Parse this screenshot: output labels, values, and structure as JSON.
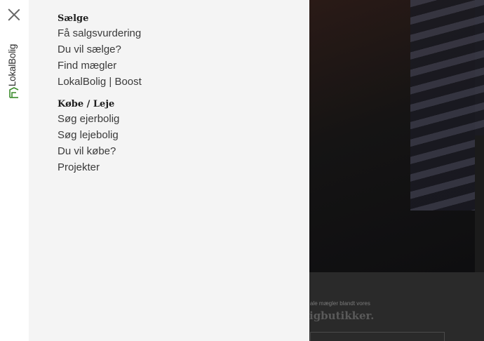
{
  "close": {
    "icon": "close-icon"
  },
  "brand": {
    "name": "LokalBolig",
    "logo_color": "#3a8a2a"
  },
  "menu": {
    "sections": [
      {
        "title": "Sælge",
        "items": [
          "Få salgsvurdering",
          "Du vil sælge?",
          "Find mægler",
          "LokalBolig | Boost"
        ]
      },
      {
        "title": "Købe / Leje",
        "items": [
          "Søg ejerbolig",
          "Søg lejebolig",
          "Du vil købe?",
          "Projekter"
        ]
      }
    ]
  },
  "background": {
    "small_text": "ale mægler blandt vores",
    "headline": "igbutikker."
  },
  "colors": {
    "panel": "#f4f4f4",
    "rail": "#ffffff",
    "overlay": "#222222"
  }
}
